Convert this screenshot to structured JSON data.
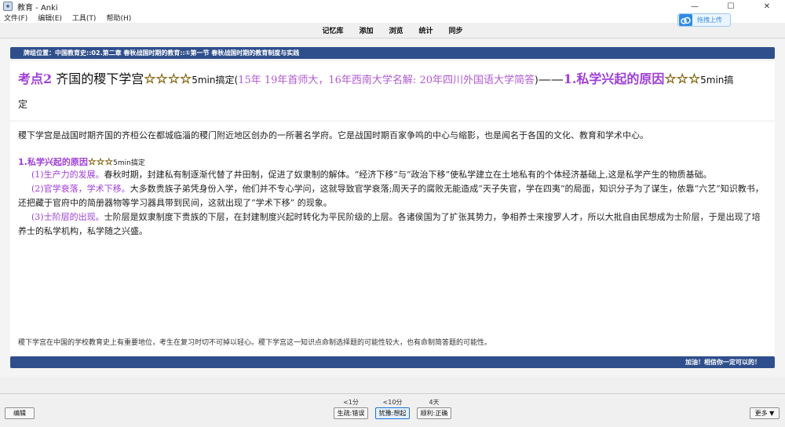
{
  "window": {
    "title": "教育 - Anki",
    "icon": "anki-app-icon",
    "controls": {
      "minimize": "—",
      "maximize": "☐",
      "close": "✕"
    }
  },
  "menu": [
    "文件(F)",
    "编辑(E)",
    "工具(T)",
    "帮助(H)"
  ],
  "toolbar": {
    "links": [
      "记忆库",
      "添加",
      "浏览",
      "统计",
      "同步"
    ],
    "upload_label": "拖拽上传",
    "upload_icon": "cloud-icon"
  },
  "card": {
    "breadcrumb": "牌组位置：中国教育史::02.第二章 春秋战国时期的教育::①第一节 春秋战国时期的教育制度与实践",
    "header": {
      "kaodian": "考点2",
      "title": "齐国的稷下学宫",
      "stars": "☆☆☆☆",
      "time1": "5min",
      "time1_suffix": "搞定(",
      "sources": "15年 19年首师大，16年西南大学名解: 20年四川外国语大学简答",
      "close_paren": ")",
      "dash": "——",
      "subtitle": "1.私学兴起的原因",
      "stars2": "☆☆☆",
      "time2": "5min",
      "time2_suffix": "搞",
      "tail": "定"
    },
    "intro": "稷下学宫是战国时期齐国的齐桓公在都城临淄的稷门附近地区创办的一所著名学府。它是战国时期百家争鸣的中心与缩影，也是闻名于各国的文化、教育和学术中心。",
    "section": {
      "title": "1.私学兴起的原因",
      "stars": "☆☆☆",
      "time": "5min",
      "time_suffix": "搞定"
    },
    "points": [
      {
        "label": "(1)生产力的发展。",
        "text": "春秋时期，封建私有制逐渐代替了井田制，促进了奴隶制的解体。“经济下移”与“政治下移”使私学建立在土地私有的个体经济基础上,这是私学产生的物质基础。"
      },
      {
        "label": "(2)官学衰落，学术下移。",
        "text": "大多数贵族子弟凭身份入学，他们并不专心学问，这就导致官学衰落;周天子的腐败无能造成“天子失官，学在四夷”的局面，知识分子为了谋生，依靠“六艺”知识教书，还把藏于官府中的简册器物等学习器具带到民间，这就出现了“学术下移” 的现象。"
      },
      {
        "label": "(3)士阶层的出现。",
        "text": "士阶层是奴隶制度下贵族的下层，在封建制度兴起时转化为平民阶级的上层。各诸侯国为了扩张其势力，争相养士来搜罗人才，所以大批自由民想成为士阶层，于是出现了培养士的私学机构，私学随之兴盛。"
      }
    ],
    "note": "稷下学宫在中国的学校教育史上有重要地位，考生在复习时切不可掉以轻心。稷下学宫这一知识点命制选择题的可能性较大，也有命制简答题的可能性。",
    "footer": "加油！相信你一定可以的！"
  },
  "bottom": {
    "edit_label": "编辑",
    "more_label": "更多 ▼",
    "answers": [
      {
        "interval": "<1分",
        "label": "生疏:错误"
      },
      {
        "interval": "<10分",
        "label": "犹豫:想起"
      },
      {
        "interval": "4天",
        "label": "顺利:正确"
      }
    ]
  }
}
